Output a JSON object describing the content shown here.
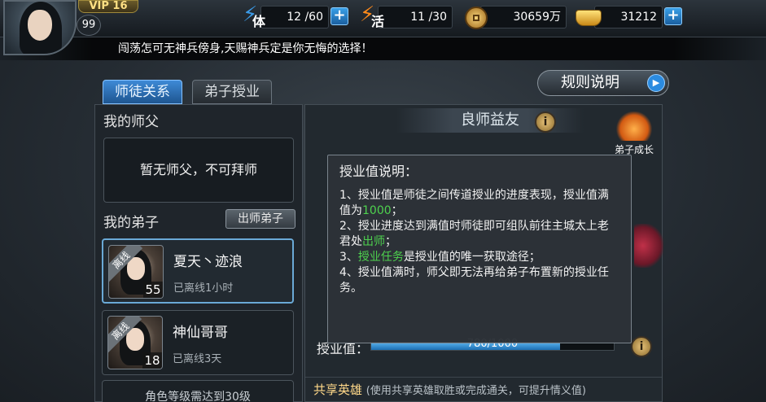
{
  "header": {
    "vip_label": "VIP 16",
    "player_level": "99",
    "stamina": {
      "icon": "stamina-icon",
      "glyph": "体",
      "value": "12 /60"
    },
    "vigor": {
      "icon": "vigor-icon",
      "glyph": "活",
      "value": "11 /30"
    },
    "coins": {
      "icon": "coin-icon",
      "value": "30659万"
    },
    "ingots": {
      "icon": "ingot-icon",
      "value": "31212"
    }
  },
  "marquee_text": "闯荡怎可无神兵傍身,天赐神兵定是你无悔的选择！",
  "tabs": [
    {
      "label": "师徒关系",
      "active": true
    },
    {
      "label": "弟子授业",
      "active": false
    }
  ],
  "rules_button": "规则说明",
  "left": {
    "master_title": "我的师父",
    "no_master_text": "暂无师父，不可拜师",
    "disciples_title": "我的弟子",
    "graduate_button": "出师弟子",
    "disciples": [
      {
        "name": "夏天丶迹浪",
        "level": "55",
        "status": "已离线1小时",
        "tag": "离线"
      },
      {
        "name": "神仙哥哥",
        "level": "18",
        "status": "已离线3天",
        "tag": "离线"
      }
    ],
    "footer_text": "角色等级需达到30级"
  },
  "right": {
    "title": "良师益友",
    "info_glyph": "i",
    "growth_label": "弟子成长",
    "value_label": "授业值：",
    "progress": {
      "current": 780,
      "max": 1000,
      "text": "780/1000"
    },
    "shared_heroes_title": "共享英雄",
    "shared_heroes_sub": "(使用共享英雄取胜或完成通关，可提升情义值)"
  },
  "tooltip": {
    "title": "授业值说明：",
    "l1a": "1、授业值是师徒之间传道授业的进度表现，授业值满值为",
    "l1b": "1000",
    "l1c": "；",
    "l2a": "2、授业进度达到满值时师徒即可组队前往主城太上老君处",
    "l2b": "出师",
    "l2c": "；",
    "l3a": "3、",
    "l3b": "授业任务",
    "l3c": "是授业值的唯一获取途径；",
    "l4": "4、授业值满时，师父即无法再给弟子布置新的授业任务。"
  },
  "colors": {
    "accent_blue": "#2b8be0",
    "highlight_green": "#4ed24e",
    "vip_gold": "#ffe083"
  }
}
